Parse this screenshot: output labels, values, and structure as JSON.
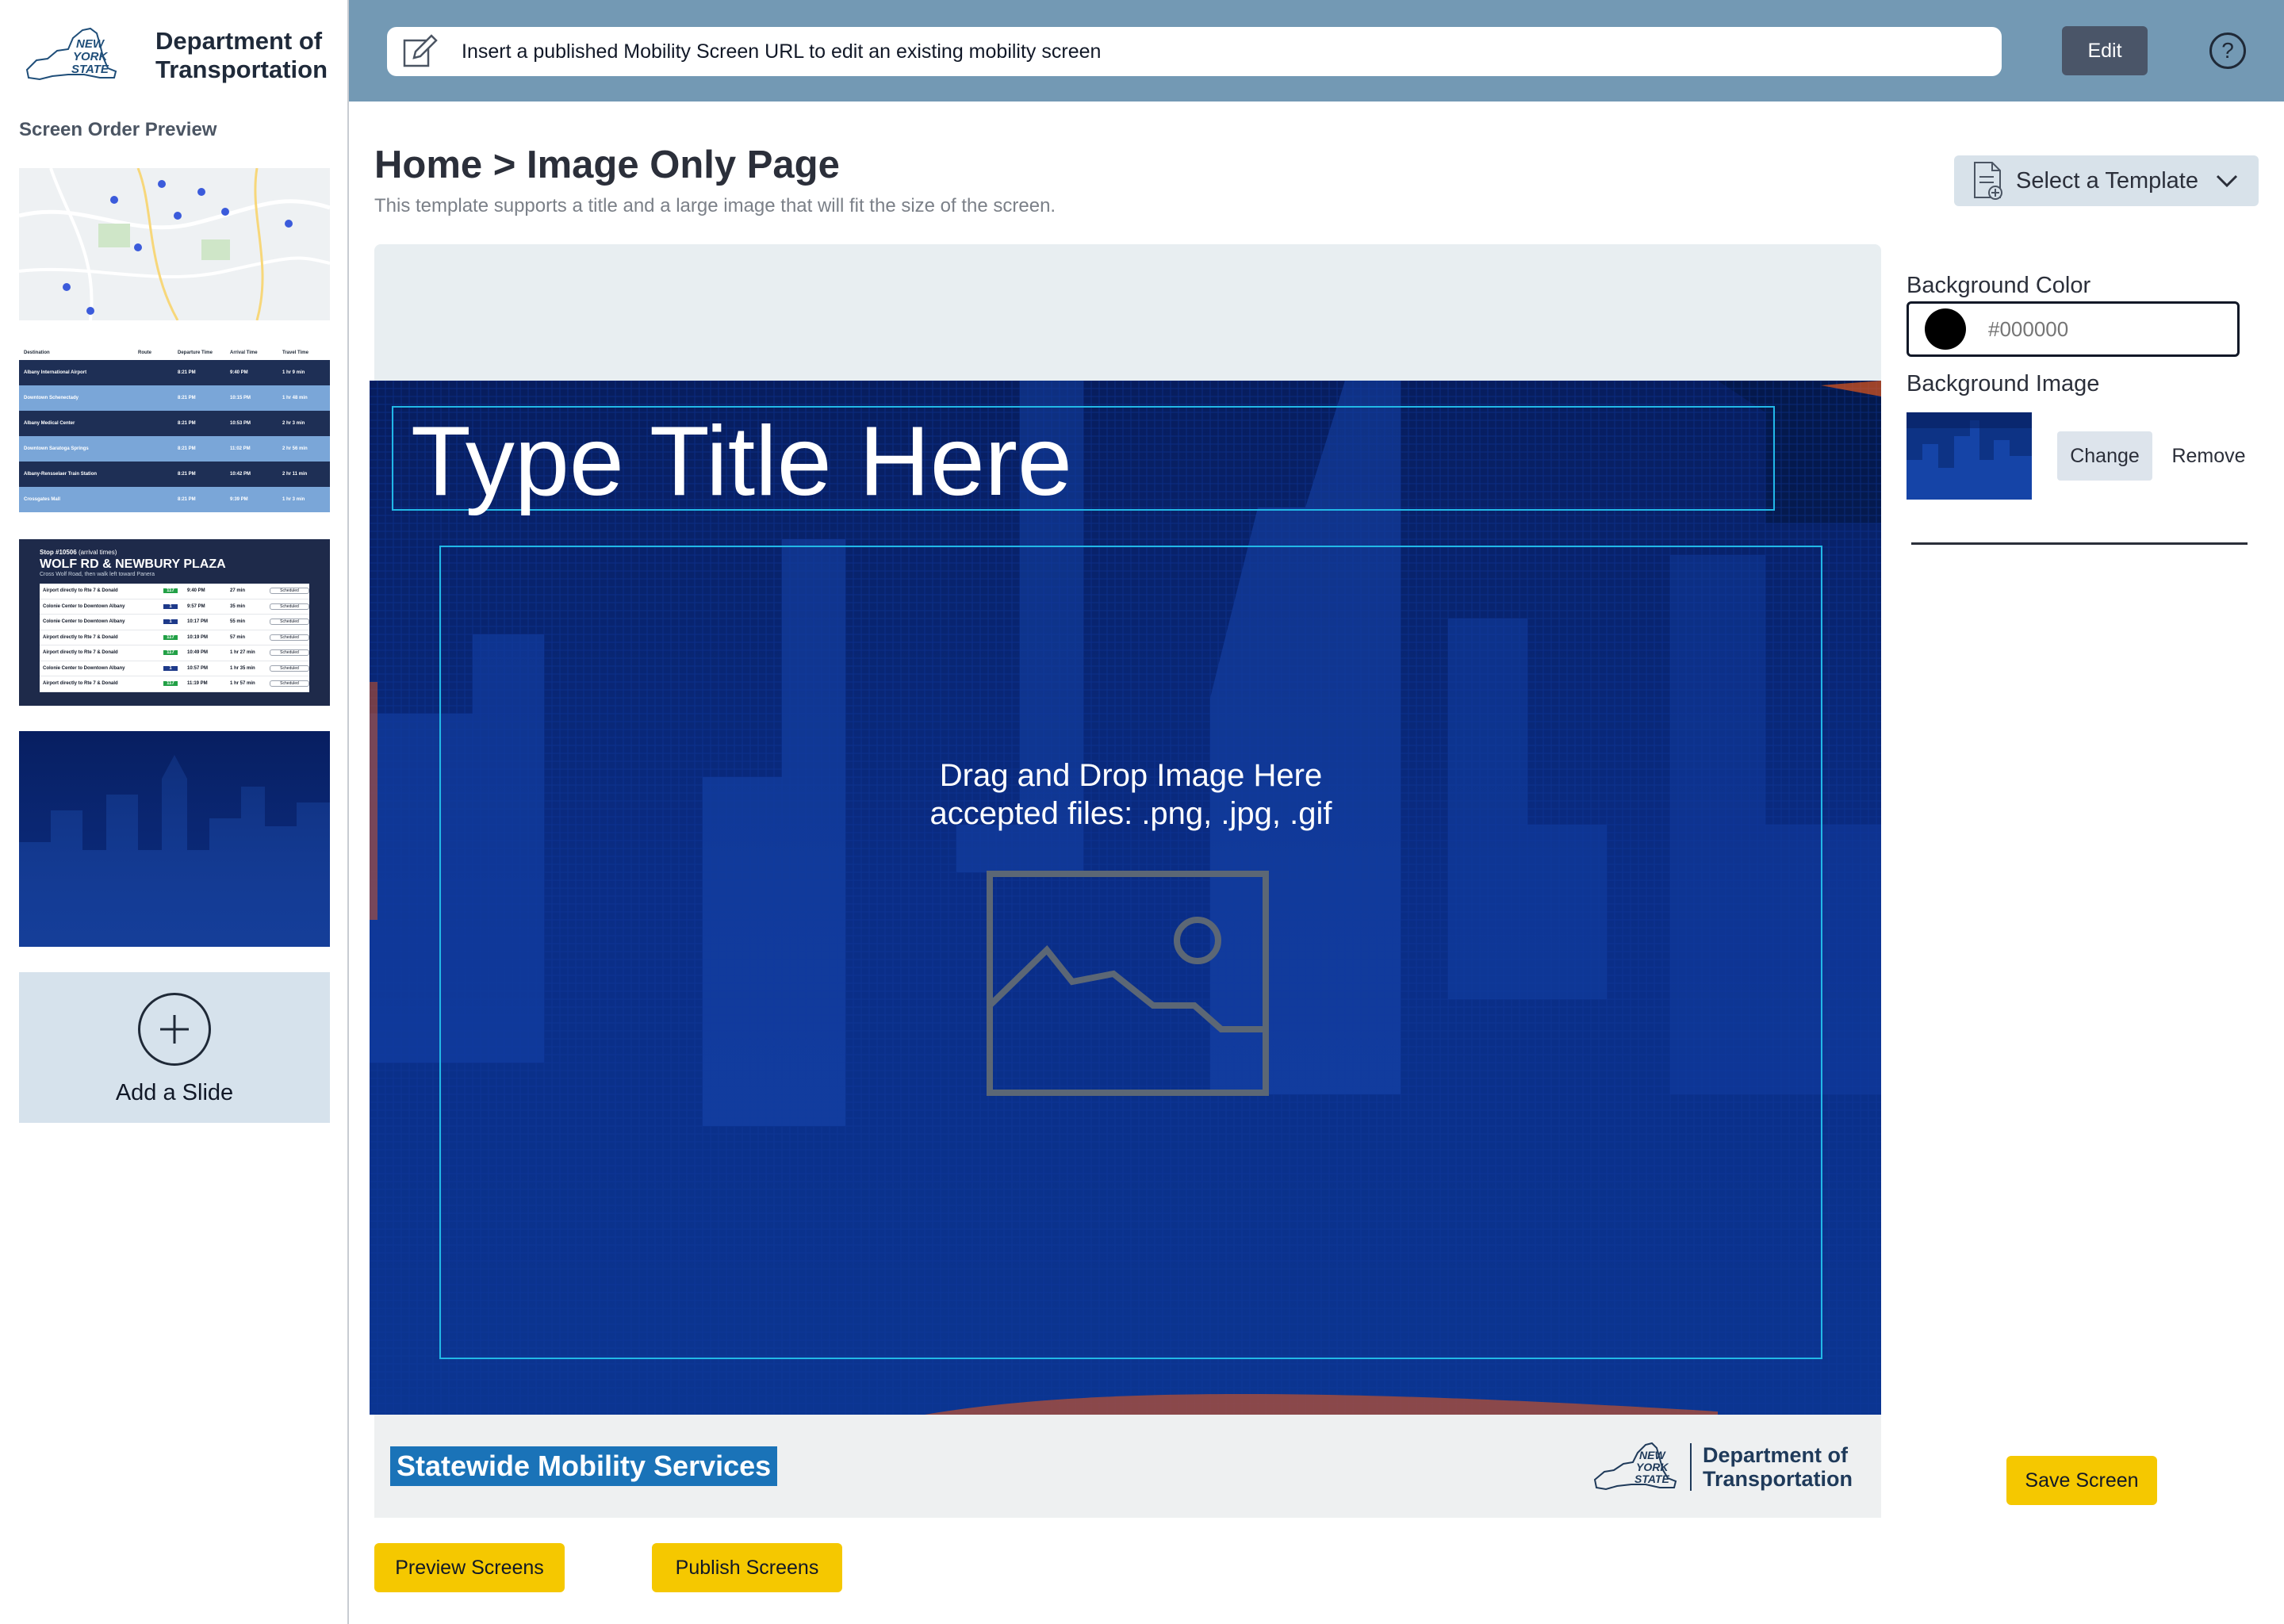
{
  "sidebar": {
    "logo": {
      "state_lines": [
        "NEW",
        "YORK",
        "STATE"
      ],
      "dept_lines": [
        "Department of",
        "Transportation"
      ]
    },
    "section_title": "Screen Order Preview",
    "add_slide_label": "Add a Slide",
    "thumb2": {
      "headers": [
        "Destination",
        "Route",
        "Departure Time",
        "Arrival Time",
        "Travel Time"
      ],
      "rows": [
        [
          "Albany International Airport",
          "",
          "8:21 PM",
          "9:40 PM",
          "1 hr 9 min"
        ],
        [
          "Downtown Schenectady",
          "",
          "8:21 PM",
          "10:15 PM",
          "1 hr 48 min"
        ],
        [
          "Albany Medical Center",
          "",
          "8:21 PM",
          "10:53 PM",
          "2 hr 3 min"
        ],
        [
          "Downtown Saratoga Springs",
          "",
          "8:21 PM",
          "11:02 PM",
          "2 hr 56 min"
        ],
        [
          "Albany-Rensselaer Train Station",
          "",
          "8:21 PM",
          "10:42 PM",
          "2 hr 11 min"
        ],
        [
          "Crossgates Mall",
          "",
          "8:21 PM",
          "9:39 PM",
          "1 hr 3 min"
        ]
      ]
    },
    "thumb3": {
      "stop": "Stop #10506",
      "stop_suffix": "(arrival times)",
      "title": "WOLF RD & NEWBURY PLAZA",
      "subtitle": "Cross Wolf Road, then walk left toward Panera",
      "rows": [
        [
          "Airport directly to Rte 7 & Donald",
          "117",
          "9:40 PM",
          "27 min",
          "Scheduled"
        ],
        [
          "Colonie Center to Downtown Albany",
          "1",
          "9:57 PM",
          "35 min",
          "Scheduled"
        ],
        [
          "Colonie Center to Downtown Albany",
          "1",
          "10:17 PM",
          "55 min",
          "Scheduled"
        ],
        [
          "Airport directly to Rte 7 & Donald",
          "117",
          "10:19 PM",
          "57 min",
          "Scheduled"
        ],
        [
          "Airport directly to Rte 7 & Donald",
          "117",
          "10:49 PM",
          "1 hr 27 min",
          "Scheduled"
        ],
        [
          "Colonie Center to Downtown Albany",
          "1",
          "10:57 PM",
          "1 hr 35 min",
          "Scheduled"
        ],
        [
          "Airport directly to Rte 7 & Donald",
          "117",
          "11:19 PM",
          "1 hr 57 min",
          "Scheduled"
        ]
      ]
    }
  },
  "topbar": {
    "url_placeholder": "Insert a published Mobility Screen URL to edit an existing mobility screen",
    "edit_label": "Edit",
    "help_symbol": "?"
  },
  "header": {
    "breadcrumb": "Home > Image Only Page",
    "subtitle": "This template supports a title and a large image that will fit the size of the screen.",
    "template_select": "Select a Template"
  },
  "canvas": {
    "title": "Type Title Here",
    "drop_line1": "Drag and Drop Image Here",
    "drop_line2": "accepted files: .png, .jpg, .gif",
    "footer_tag": "Statewide Mobility Services",
    "footer_logo": {
      "state_lines": [
        "NEW",
        "YORK",
        "STATE"
      ],
      "dept_lines": [
        "Department of",
        "Transportation"
      ]
    }
  },
  "panel": {
    "bg_color_label": "Background Color",
    "bg_color_value": "#000000",
    "bg_image_label": "Background Image",
    "change_label": "Change",
    "remove_label": "Remove",
    "save_label": "Save Screen"
  },
  "actions": {
    "preview_label": "Preview Screens",
    "publish_label": "Publish Screens"
  },
  "colors": {
    "topbar": "#7399b4",
    "accent_yellow": "#f5c800",
    "canvas_blue": "#0a2d86",
    "frame_cyan": "#22b8e6"
  }
}
